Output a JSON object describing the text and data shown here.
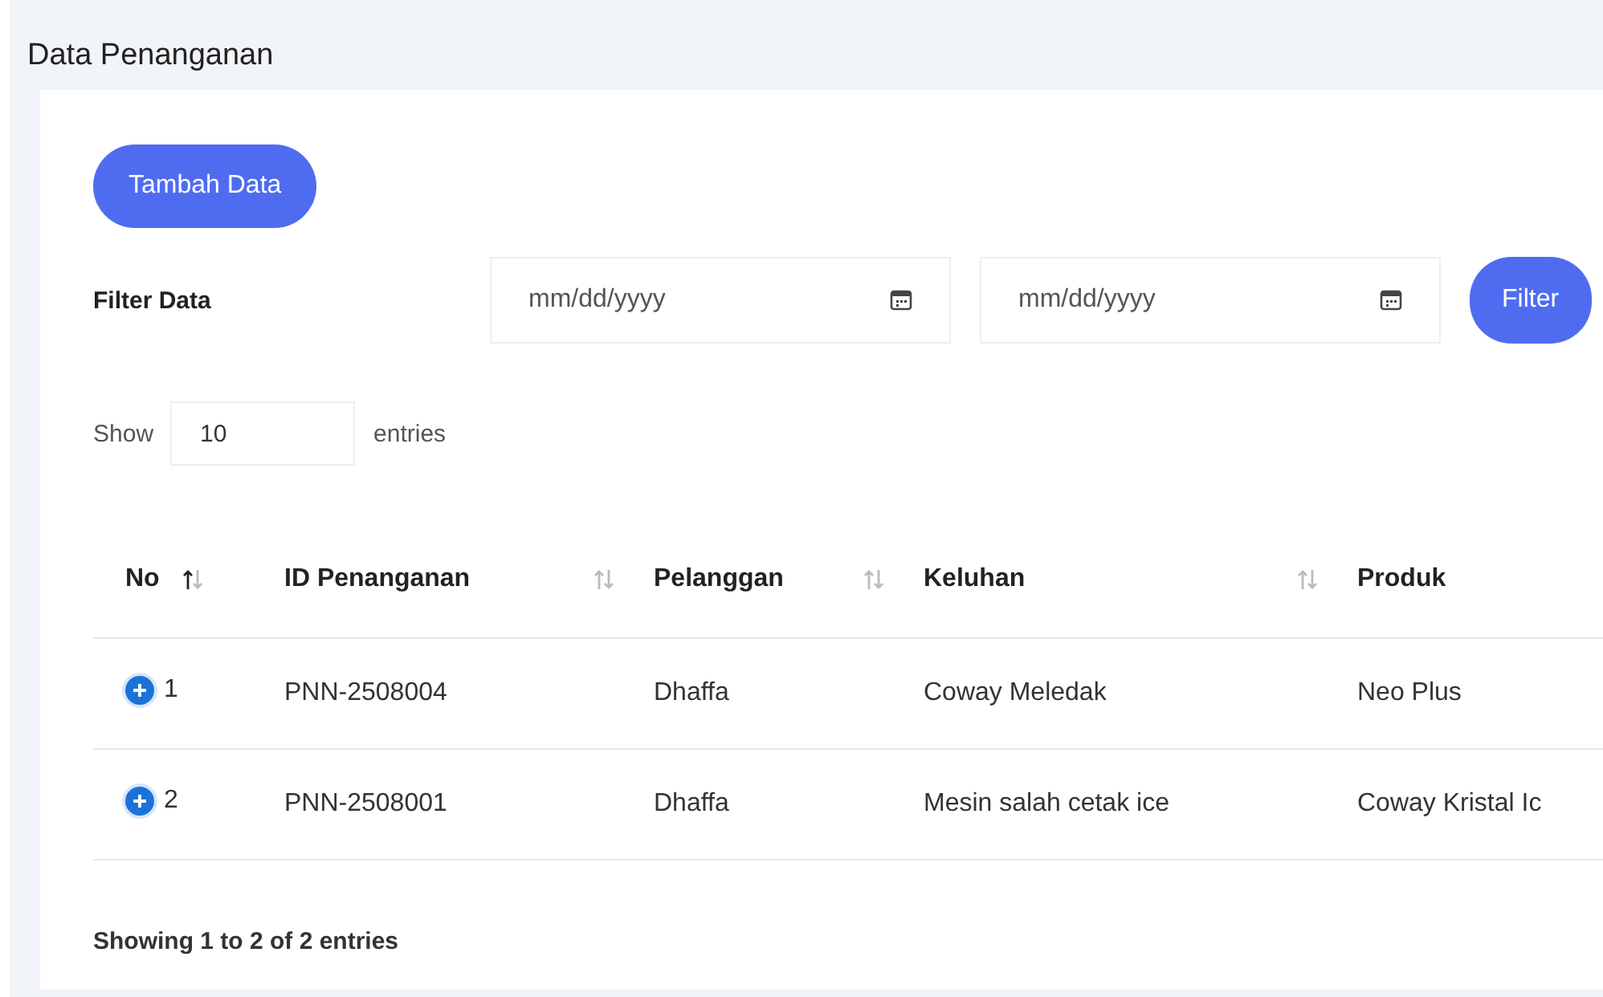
{
  "page": {
    "title": "Data Penanganan"
  },
  "add_button": "Tambah Data",
  "filter": {
    "label": "Filter Data",
    "date_fields": [
      {
        "placeholder": "mm/dd/yyyy"
      },
      {
        "placeholder": "mm/dd/yyyy"
      }
    ],
    "button": "Filter"
  },
  "length": {
    "before": "Show",
    "value": "10",
    "after": "entries"
  },
  "table": {
    "columns": [
      {
        "label": "No",
        "sorted": true
      },
      {
        "label": "ID Penanganan",
        "sorted": false
      },
      {
        "label": "Pelanggan",
        "sorted": false
      },
      {
        "label": "Keluhan",
        "sorted": false
      },
      {
        "label": "Produk"
      }
    ],
    "rows": [
      {
        "expanded": false,
        "cells": [
          "1",
          "PNN-2508004",
          "Dhaffa",
          "Coway Meledak",
          "Neo Plus"
        ]
      },
      {
        "expanded": false,
        "cells": [
          "2",
          "PNN-2508001",
          "Dhaffa",
          "Mesin salah cetak ice",
          "Coway Kristal Ic"
        ]
      }
    ]
  },
  "info": "Showing 1 to 2 of 2 entries"
}
